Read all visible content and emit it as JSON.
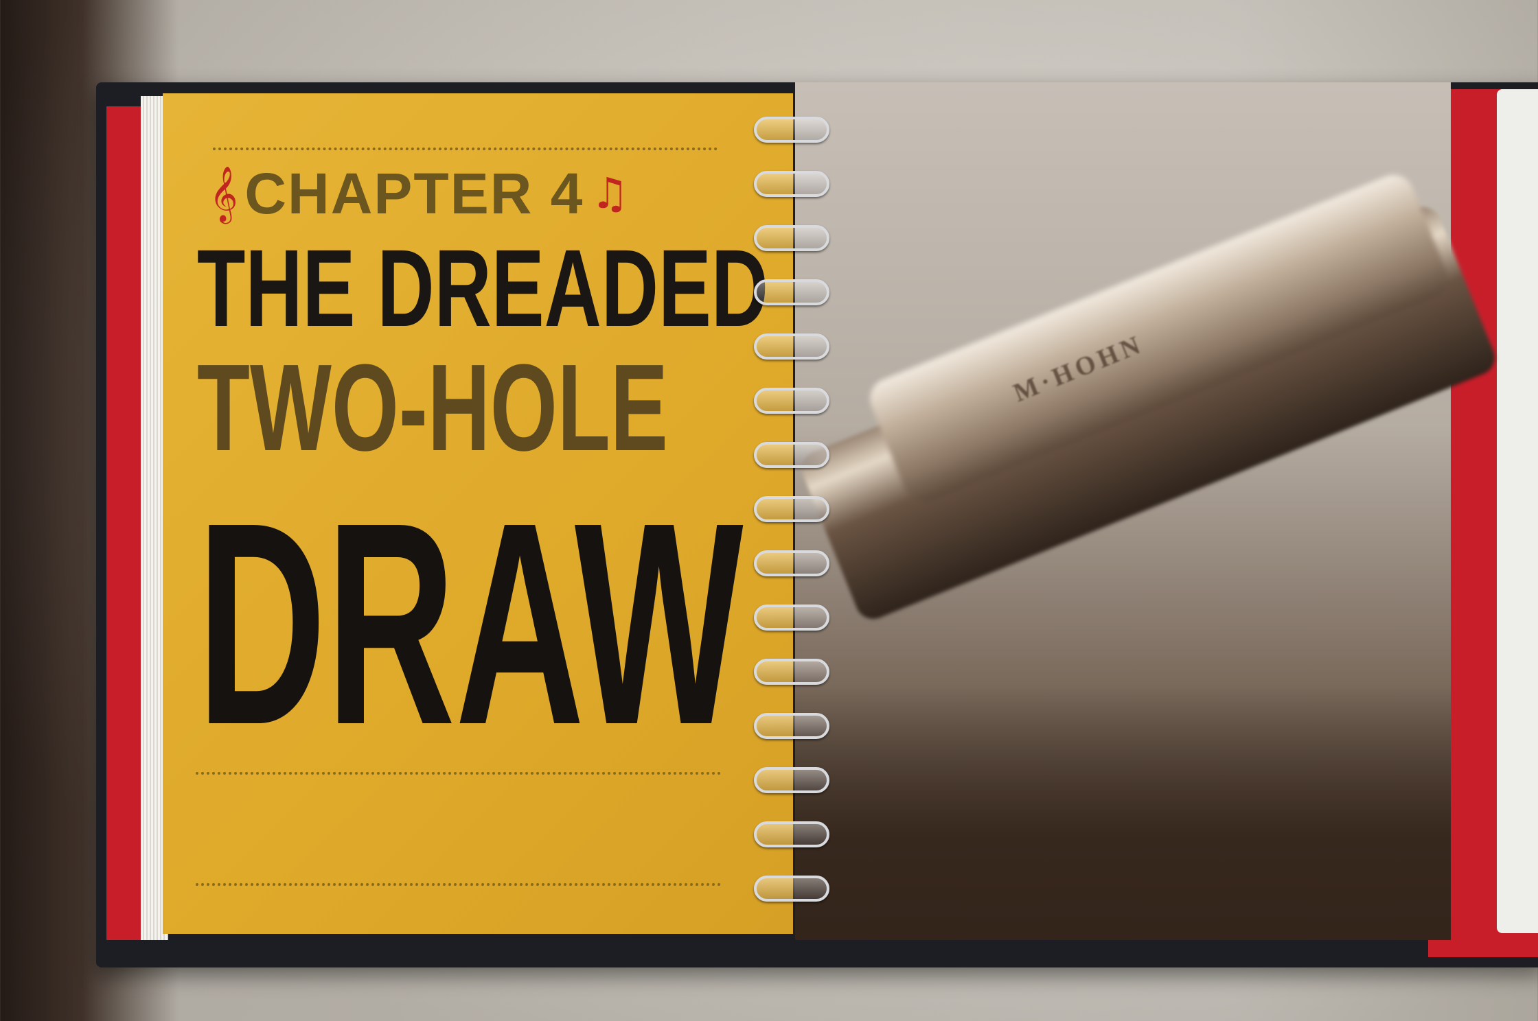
{
  "left_page": {
    "chapter_label": "CHAPTER 4",
    "title_line_1": "THE DREADED",
    "title_line_2": "TWO-HOLE",
    "title_line_3": "DRAW"
  },
  "right_page": {
    "harmonica_engraving": "M·HOHN"
  },
  "icons": {
    "left": "treble-clef-icon",
    "right": "music-note-icon"
  },
  "colors": {
    "page_yellow": "#e2ae31",
    "accent_red": "#c0261f",
    "title_dark": "#1a1614",
    "title_brown": "#5e4a1e",
    "cover_red": "#c81e2a"
  }
}
